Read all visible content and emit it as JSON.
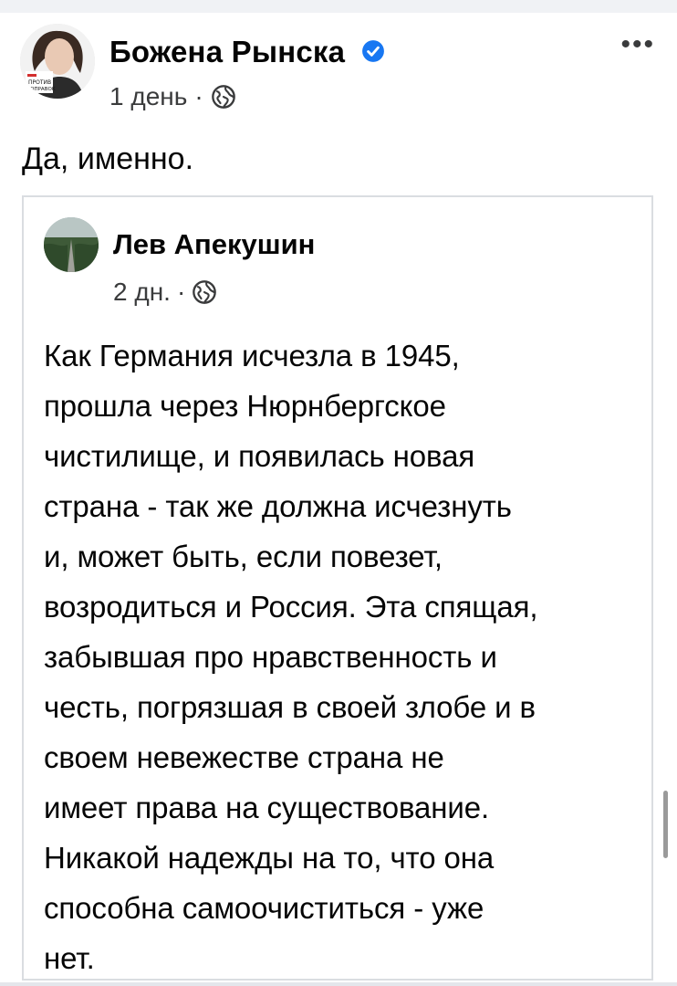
{
  "post": {
    "author": "Божена Рынска",
    "avatar_badge": "ПРОТИВ ПОПРАВОК",
    "time": "1 день",
    "separator": "·",
    "privacy_icon": "globe-icon",
    "more_icon": "ellipsis-icon",
    "more_label": "•••",
    "text": "Да, именно.",
    "verified_color": "#1877f2"
  },
  "shared_post": {
    "author": "Лев Апекушин",
    "time": "2 дн.",
    "separator": "·",
    "privacy_icon": "globe-icon",
    "lines": [
      "Как Германия исчезла в 1945,",
      "прошла через Нюрнбергское",
      "чистилище, и появилась новая",
      "страна - так же должна исчезнуть",
      "и, может быть, если повезет,",
      "возродиться и Россия. Эта спящая,",
      "забывшая про нравственность и",
      "честь, погрязшая в своей злобе и в",
      "своем невежестве страна не",
      "имеет права на существование.",
      "Никакой надежды на то, что она",
      "способна самоочиститься - уже",
      "нет."
    ]
  }
}
